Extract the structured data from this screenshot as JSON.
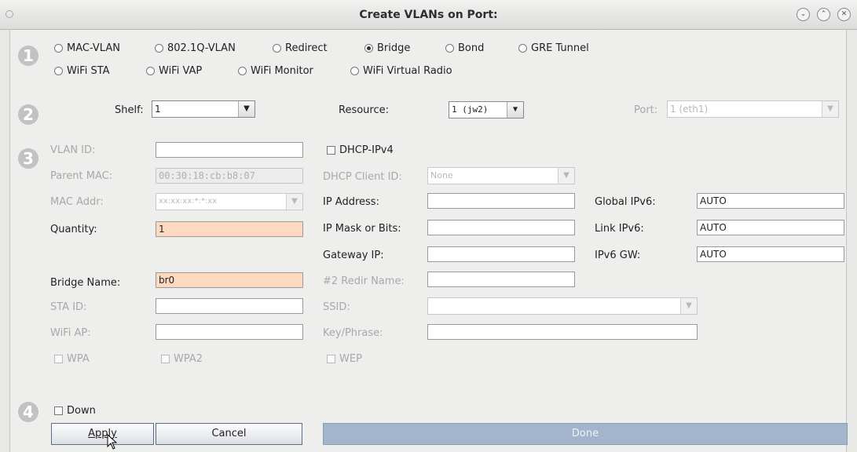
{
  "window": {
    "title": "Create VLANs on Port:",
    "buttons": [
      "⌄",
      "⌃",
      "✕"
    ]
  },
  "steps": [
    "1",
    "2",
    "3",
    "4"
  ],
  "types": {
    "row1": [
      {
        "label": "MAC-VLAN",
        "selected": false
      },
      {
        "label": "802.1Q-VLAN",
        "selected": false
      },
      {
        "label": "Redirect",
        "selected": false
      },
      {
        "label": "Bridge",
        "selected": true
      },
      {
        "label": "Bond",
        "selected": false
      },
      {
        "label": "GRE Tunnel",
        "selected": false
      }
    ],
    "row2": [
      {
        "label": "WiFi STA",
        "selected": false
      },
      {
        "label": "WiFi VAP",
        "selected": false
      },
      {
        "label": "WiFi Monitor",
        "selected": false
      },
      {
        "label": "WiFi Virtual Radio",
        "selected": false
      }
    ]
  },
  "selectors": {
    "shelf_label": "Shelf:",
    "shelf_value": "1",
    "resource_label": "Resource:",
    "resource_value": "1 (jw2)",
    "port_label": "Port:",
    "port_value": "1 (eth1)"
  },
  "form": {
    "vlan_id_label": "VLAN ID:",
    "vlan_id_value": "",
    "parent_mac_label": "Parent MAC:",
    "parent_mac_value": "00:30:18:cb:b8:07",
    "mac_addr_label": "MAC Addr:",
    "mac_addr_value": "xx:xx:xx:*:*:xx",
    "quantity_label": "Quantity:",
    "quantity_value": "1",
    "bridge_name_label": "Bridge Name:",
    "bridge_name_value": "br0",
    "sta_id_label": "STA ID:",
    "sta_id_value": "",
    "wifi_ap_label": "WiFi AP:",
    "wifi_ap_value": "",
    "wpa_label": "WPA",
    "wpa2_label": "WPA2",
    "dhcp_ipv4_label": "DHCP-IPv4",
    "dhcp_client_id_label": "DHCP Client ID:",
    "dhcp_client_id_value": "None",
    "ip_address_label": "IP Address:",
    "ip_address_value": "",
    "ip_mask_label": "IP Mask or Bits:",
    "ip_mask_value": "",
    "gateway_ip_label": "Gateway IP:",
    "gateway_ip_value": "",
    "redir_name_label": "#2 Redir Name:",
    "redir_name_value": "",
    "ssid_label": "SSID:",
    "ssid_value": "",
    "key_phrase_label": "Key/Phrase:",
    "key_phrase_value": "",
    "wep_label": "WEP",
    "global_ipv6_label": "Global IPv6:",
    "global_ipv6_value": "AUTO",
    "link_ipv6_label": "Link IPv6:",
    "link_ipv6_value": "AUTO",
    "ipv6_gw_label": "IPv6 GW:",
    "ipv6_gw_value": "AUTO"
  },
  "footer": {
    "down_label": "Down",
    "apply_label": "Apply",
    "cancel_label": "Cancel",
    "done_label": "Done"
  },
  "colors": {
    "required_field": "#fdd9bf",
    "done_button": "#a2b5cd"
  }
}
